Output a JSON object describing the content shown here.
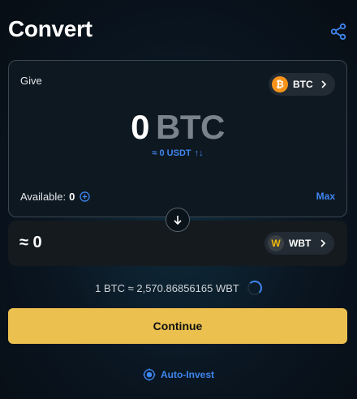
{
  "header": {
    "title": "Convert",
    "share_icon": "share-icon"
  },
  "give": {
    "label": "Give",
    "coin": {
      "name": "BTC",
      "symbol": "₿",
      "icon": "bitcoin-icon"
    },
    "amount": "0",
    "currency": "BTC",
    "approx_usdt": "≈ 0 USDT",
    "swap_glyph": "↑↓",
    "available_label": "Available:",
    "available_value": "0",
    "max_label": "Max"
  },
  "receive": {
    "amount": "≈ 0",
    "coin": {
      "name": "WBT",
      "symbol": "W",
      "icon": "whitebit-icon"
    }
  },
  "rate": {
    "text": "1 BTC ≈ 2,570.86856165 WBT"
  },
  "continue_label": "Continue",
  "auto_invest_label": "Auto-Invest",
  "colors": {
    "accent_blue": "#3f86f0",
    "continue_yellow": "#ebc04f",
    "btc_orange": "#f7931a",
    "card_bg": "#0e1821"
  }
}
